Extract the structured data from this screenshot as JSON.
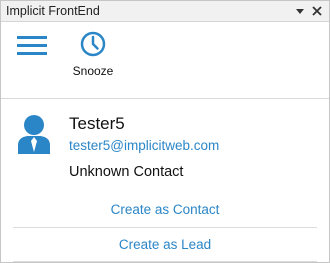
{
  "window": {
    "title": "Implicit FrontEnd",
    "dropdown_icon": "triangle-down-icon",
    "close_icon": "close-icon"
  },
  "toolbar": {
    "menu_icon": "hamburger-menu-icon",
    "snooze_icon": "clock-icon",
    "snooze_label": "Snooze"
  },
  "contact": {
    "avatar_icon": "person-icon",
    "name": "Tester5",
    "email": "tester5@implicitweb.com",
    "status": "Unknown Contact"
  },
  "actions": {
    "create_contact": "Create as Contact",
    "create_lead": "Create as Lead"
  },
  "colors": {
    "accent": "#2b86c7",
    "text": "#111111",
    "titlebar_bg": "#f1f1f1",
    "divider": "#d9d9d9"
  }
}
